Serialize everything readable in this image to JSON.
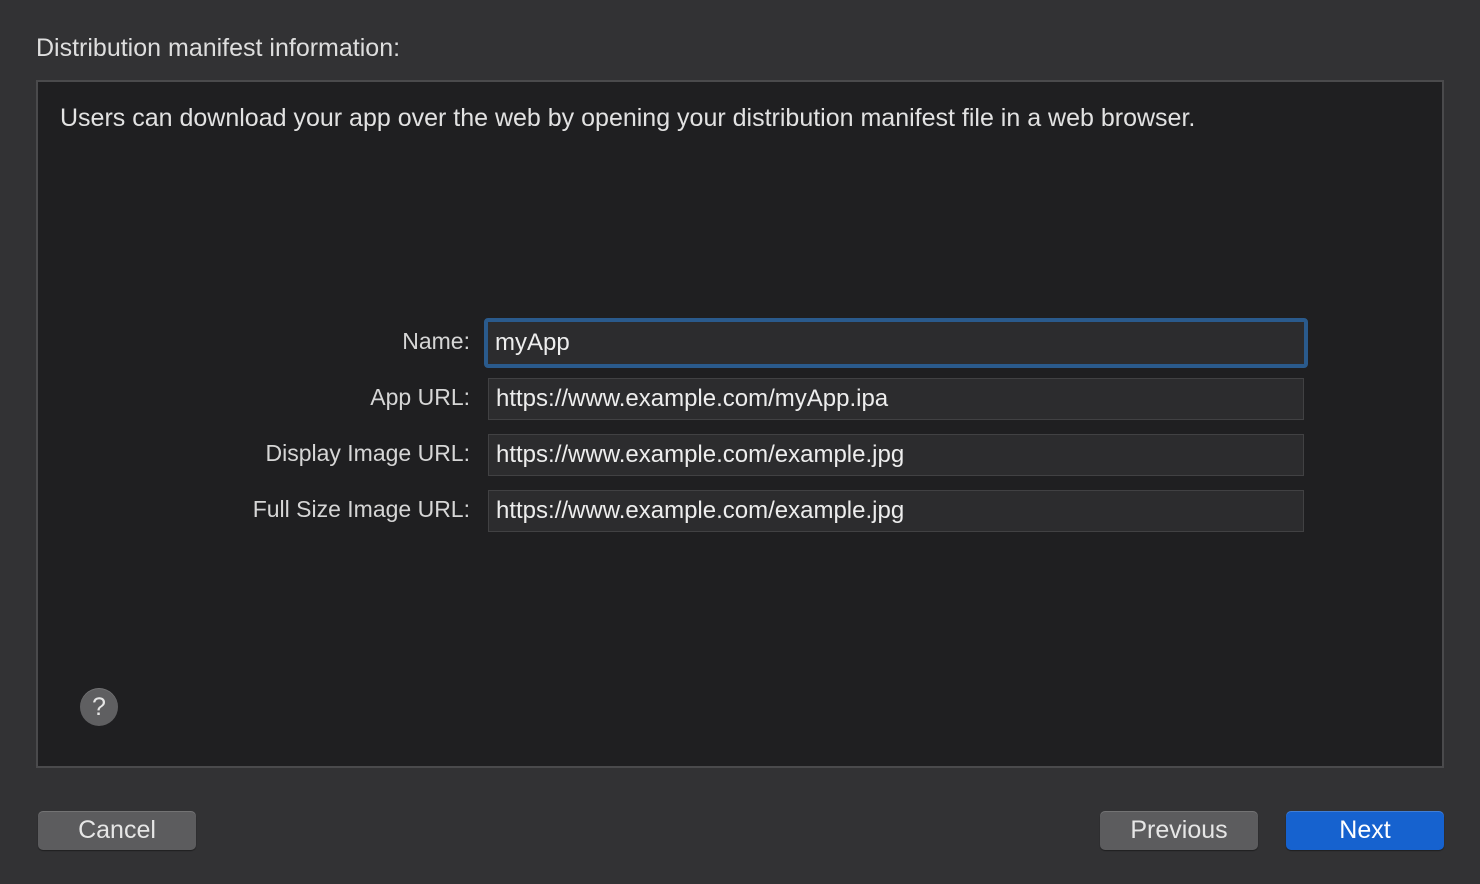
{
  "header": {
    "title": "Distribution manifest information:"
  },
  "panel": {
    "description": "Users can download your app over the web by opening your distribution manifest file in a web browser."
  },
  "form": {
    "name": {
      "label": "Name:",
      "value": "myApp"
    },
    "app_url": {
      "label": "App URL:",
      "value": "https://www.example.com/myApp.ipa"
    },
    "display_image_url": {
      "label": "Display Image URL:",
      "value": "https://www.example.com/example.jpg"
    },
    "full_size_image_url": {
      "label": "Full Size Image URL:",
      "value": "https://www.example.com/example.jpg"
    }
  },
  "help": {
    "glyph": "?"
  },
  "footer": {
    "cancel_label": "Cancel",
    "previous_label": "Previous",
    "next_label": "Next"
  },
  "colors": {
    "accent": "#1662cf",
    "focus_ring": "#2a5a8c",
    "panel_background": "#1f1f21",
    "window_background": "#323234"
  }
}
